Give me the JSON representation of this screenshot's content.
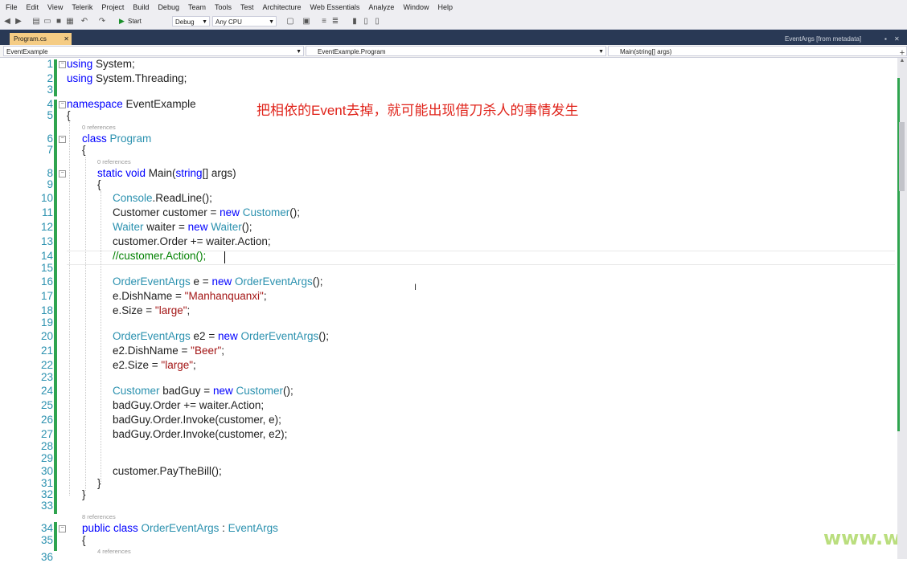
{
  "menu": [
    "File",
    "Edit",
    "View",
    "Telerik",
    "Project",
    "Build",
    "Debug",
    "Team",
    "Tools",
    "Test",
    "Architecture",
    "Web Essentials",
    "Analyze",
    "Window",
    "Help"
  ],
  "toolbar": {
    "start_label": "Start",
    "config": "Debug",
    "platform": "Any CPU"
  },
  "tabs": {
    "active": "Program.cs",
    "metadata": "EventArgs [from metadata]"
  },
  "navbar": {
    "project": "EventExample",
    "type": "EventExample.Program",
    "member": "Main(string[] args)"
  },
  "annotation": "把相依的Event去掉，就可能出现借刀杀人的事情发生",
  "watermark": "www.w",
  "code": {
    "line_numbers": [
      "1",
      "2",
      "3",
      "4",
      "5",
      "6",
      "7",
      "8",
      "9",
      "10",
      "11",
      "12",
      "13",
      "14",
      "15",
      "16",
      "17",
      "18",
      "19",
      "20",
      "21",
      "22",
      "23",
      "24",
      "25",
      "26",
      "27",
      "28",
      "29",
      "30",
      "31",
      "32",
      "33",
      "34",
      "35",
      "36"
    ],
    "ref0": "0 references",
    "ref8": "8 references",
    "ref4": "4 references",
    "l1_kw": "using",
    "l1_rest": " System;",
    "l2_kw": "using",
    "l2_rest": " System.Threading;",
    "l4_kw": "namespace",
    "l4_rest": " EventExample",
    "open_brace": "{",
    "close_brace": "}",
    "l6_kw": "class",
    "l6_ty": "Program",
    "l8_kw": "static void",
    "l8_a": " Main(",
    "l8_kw2": "string",
    "l8_b": "[] args)",
    "l10_ty": "Console",
    "l10_rest": ".ReadLine();",
    "l11_a": "Customer customer = ",
    "l11_kw": "new",
    "l11_ty": "Customer",
    "l11_b": "();",
    "l12_ty": "Waiter",
    "l12_a": " waiter = ",
    "l12_kw": "new",
    "l12_ty2": "Waiter",
    "l12_b": "();",
    "l13": "customer.Order += waiter.Action;",
    "l14": "//customer.Action();",
    "l16_ty": "OrderEventArgs",
    "l16_a": " e = ",
    "l16_kw": "new",
    "l16_ty2": "OrderEventArgs",
    "l16_b": "();",
    "l17_a": "e.DishName = ",
    "l17_st": "\"Manhanquanxi\"",
    "l17_b": ";",
    "l18_a": "e.Size = ",
    "l18_st": "\"large\"",
    "l18_b": ";",
    "l20_ty": "OrderEventArgs",
    "l20_a": " e2 = ",
    "l20_kw": "new",
    "l20_ty2": "OrderEventArgs",
    "l20_b": "();",
    "l21_a": "e2.DishName = ",
    "l21_st": "\"Beer\"",
    "l21_b": ";",
    "l22_a": "e2.Size = ",
    "l22_st": "\"large\"",
    "l22_b": ";",
    "l24_ty": "Customer",
    "l24_a": " badGuy = ",
    "l24_kw": "new",
    "l24_ty2": "Customer",
    "l24_b": "();",
    "l25": "badGuy.Order += waiter.Action;",
    "l26": "badGuy.Order.Invoke(customer, e);",
    "l27": "badGuy.Order.Invoke(customer, e2);",
    "l30": "customer.PayTheBill();",
    "l34_kw": "public class",
    "l34_ty": "OrderEventArgs",
    "l34_a": " : ",
    "l34_ty2": "EventArgs"
  }
}
